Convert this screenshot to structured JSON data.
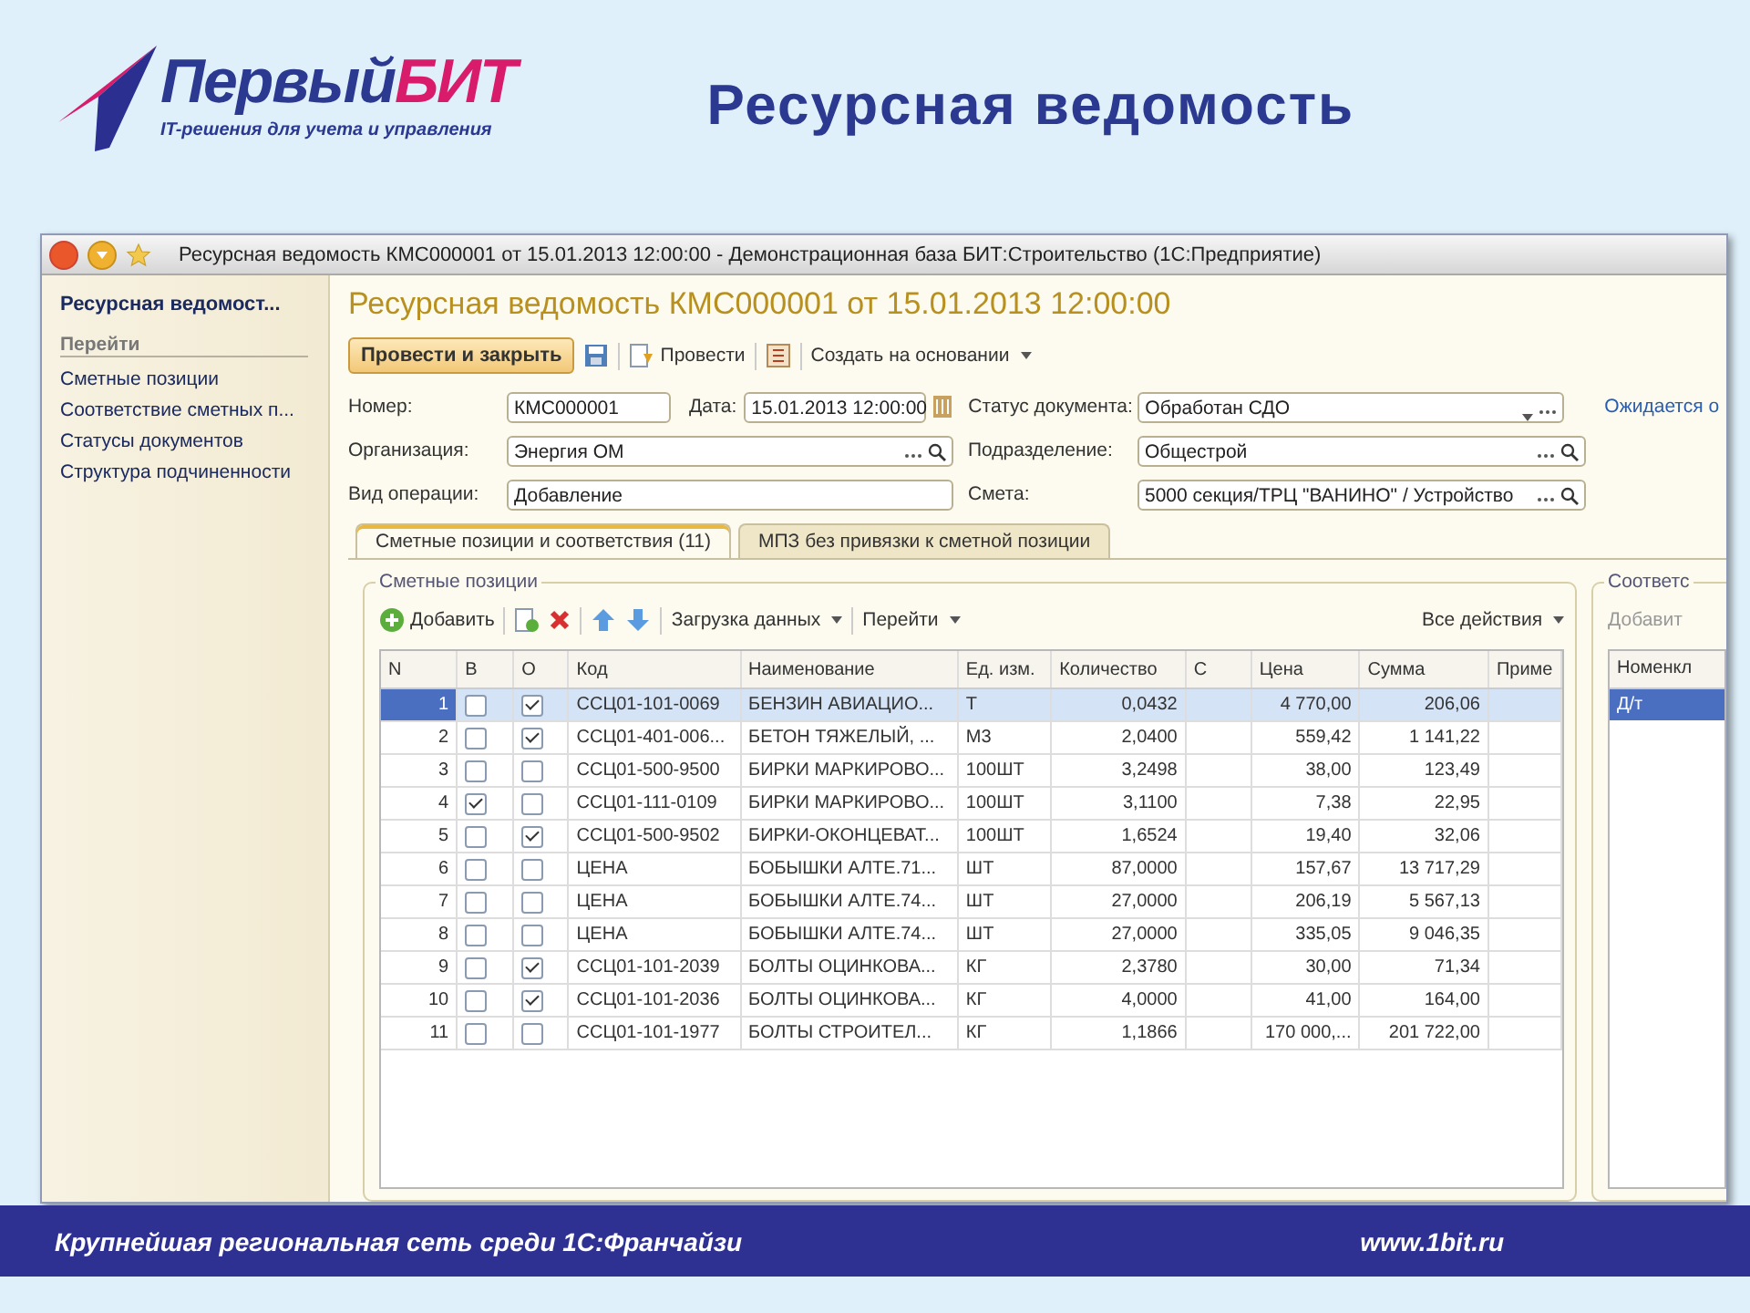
{
  "slide": {
    "logo": {
      "word": "Первый",
      "accent_word": "БИТ",
      "tagline": "IT-решения для учета и управления"
    },
    "title": "Ресурсная ведомость",
    "footer": {
      "slogan": "Крупнейшая региональная сеть среди 1С:Франчайзи",
      "url": "www.1bit.ru"
    }
  },
  "window": {
    "title": "Ресурсная ведомость КМС000001 от 15.01.2013 12:00:00 - Демонстрационная база БИТ:Строительство  (1С:Предприятие)"
  },
  "sidebar": {
    "title": "Ресурсная ведомост...",
    "section": "Перейти",
    "items": [
      "Сметные позиции",
      "Соответствие сметных п...",
      "Статусы документов",
      "Структура подчиненности"
    ]
  },
  "form": {
    "heading": "Ресурсная ведомость КМС000001 от 15.01.2013 12:00:00",
    "toolbar": {
      "primary": "Провести и закрыть",
      "post": "Провести",
      "create_based": "Создать на основании"
    },
    "fields": {
      "number_label": "Номер:",
      "number": "КМС000001",
      "date_label": "Дата:",
      "date": "15.01.2013 12:00:00",
      "status_label": "Статус документа:",
      "status": "Обработан СДО",
      "status_link": "Ожидается о",
      "org_label": "Организация:",
      "org": "Энергия ОМ",
      "dept_label": "Подразделение:",
      "dept": "Общестрой",
      "op_label": "Вид операции:",
      "op": "Добавление",
      "estimate_label": "Смета:",
      "estimate": "5000 секция/ТРЦ \"ВАНИНО\" / Устройство"
    },
    "tabs": [
      {
        "label": "Сметные позиции и соответствия (11)",
        "selected": true
      },
      {
        "label": "МПЗ без привязки к сметной позиции",
        "selected": false
      }
    ],
    "positions": {
      "title": "Сметные позиции",
      "toolbar": {
        "add": "Добавить",
        "load": "Загрузка данных",
        "goto": "Перейти",
        "all_actions": "Все действия"
      },
      "columns": [
        "N",
        "В",
        "О",
        "Код",
        "Наименование",
        "Ед. изм.",
        "Количество",
        "С",
        "Цена",
        "Сумма",
        "Приме"
      ],
      "rows": [
        {
          "n": "1",
          "b": false,
          "o": true,
          "code": "ССЦ01-101-0069",
          "name": "БЕНЗИН АВИАЦИО...",
          "unit": "Т",
          "qty": "0,0432",
          "price": "4 770,00",
          "sum": "206,06",
          "selected": true
        },
        {
          "n": "2",
          "b": false,
          "o": true,
          "code": "ССЦ01-401-006...",
          "name": "БЕТОН ТЯЖЕЛЫЙ, ...",
          "unit": "М3",
          "qty": "2,0400",
          "price": "559,42",
          "sum": "1 141,22",
          "selected": false
        },
        {
          "n": "3",
          "b": false,
          "o": false,
          "code": "ССЦ01-500-9500",
          "name": "БИРКИ МАРКИРОВО...",
          "unit": "100ШТ",
          "qty": "3,2498",
          "price": "38,00",
          "sum": "123,49",
          "selected": false
        },
        {
          "n": "4",
          "b": true,
          "o": false,
          "code": "ССЦ01-111-0109",
          "name": "БИРКИ МАРКИРОВО...",
          "unit": "100ШТ",
          "qty": "3,1100",
          "price": "7,38",
          "sum": "22,95",
          "selected": false
        },
        {
          "n": "5",
          "b": false,
          "o": true,
          "code": "ССЦ01-500-9502",
          "name": "БИРКИ-ОКОНЦЕВАТ...",
          "unit": "100ШТ",
          "qty": "1,6524",
          "price": "19,40",
          "sum": "32,06",
          "selected": false
        },
        {
          "n": "6",
          "b": false,
          "o": false,
          "code": "ЦЕНА",
          "name": "БОБЫШКИ АЛТЕ.71...",
          "unit": "ШТ",
          "qty": "87,0000",
          "price": "157,67",
          "sum": "13 717,29",
          "selected": false
        },
        {
          "n": "7",
          "b": false,
          "o": false,
          "code": "ЦЕНА",
          "name": "БОБЫШКИ АЛТЕ.74...",
          "unit": "ШТ",
          "qty": "27,0000",
          "price": "206,19",
          "sum": "5 567,13",
          "selected": false
        },
        {
          "n": "8",
          "b": false,
          "o": false,
          "code": "ЦЕНА",
          "name": "БОБЫШКИ АЛТЕ.74...",
          "unit": "ШТ",
          "qty": "27,0000",
          "price": "335,05",
          "sum": "9 046,35",
          "selected": false
        },
        {
          "n": "9",
          "b": false,
          "o": true,
          "code": "ССЦ01-101-2039",
          "name": "БОЛТЫ ОЦИНКОВА...",
          "unit": "КГ",
          "qty": "2,3780",
          "price": "30,00",
          "sum": "71,34",
          "selected": false
        },
        {
          "n": "10",
          "b": false,
          "o": true,
          "code": "ССЦ01-101-2036",
          "name": "БОЛТЫ ОЦИНКОВА...",
          "unit": "КГ",
          "qty": "4,0000",
          "price": "41,00",
          "sum": "164,00",
          "selected": false
        },
        {
          "n": "11",
          "b": false,
          "o": false,
          "code": "ССЦ01-101-1977",
          "name": "БОЛТЫ СТРОИТЕЛ...",
          "unit": "КГ",
          "qty": "1,1866",
          "price": "170 000,...",
          "sum": "201 722,00",
          "selected": false
        }
      ]
    },
    "matches": {
      "title": "Соответс",
      "add": "Добавит",
      "column": "Номенкл",
      "rows": [
        {
          "value": "Д/т",
          "selected": true
        }
      ]
    }
  }
}
